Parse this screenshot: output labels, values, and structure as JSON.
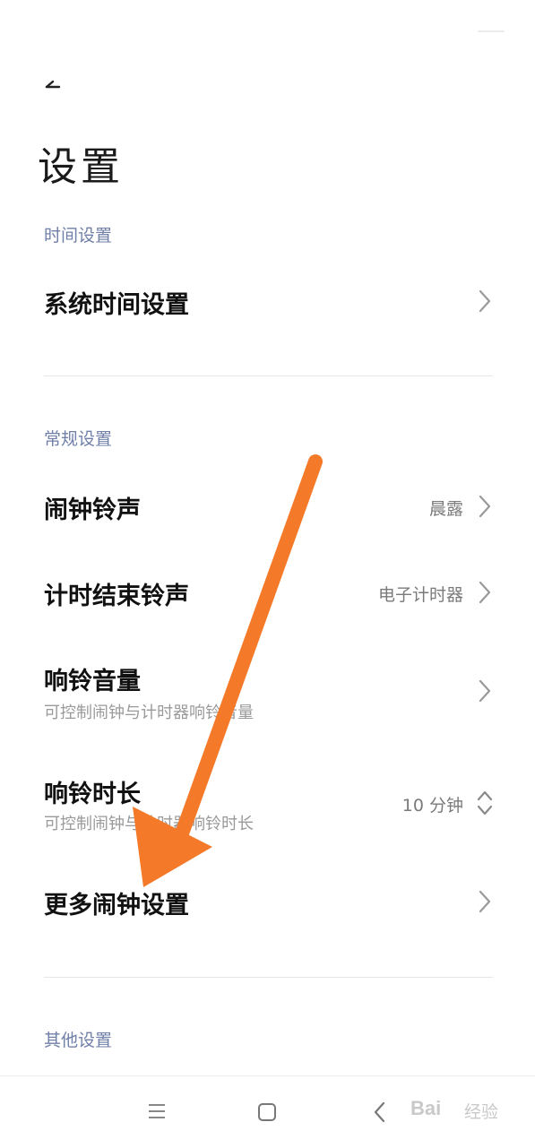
{
  "header": {
    "title": "设置"
  },
  "sections": {
    "time": {
      "label": "时间设置"
    },
    "general": {
      "label": "常规设置"
    },
    "other": {
      "label": "其他设置"
    }
  },
  "rows": {
    "system_time": {
      "title": "系统时间设置"
    },
    "alarm_ringtone": {
      "title": "闹钟铃声",
      "value": "晨露"
    },
    "timer_ringtone": {
      "title": "计时结束铃声",
      "value": "电子计时器"
    },
    "ring_volume": {
      "title": "响铃音量",
      "subtitle": "可控制闹钟与计时器响铃音量"
    },
    "ring_duration": {
      "title": "响铃时长",
      "subtitle": "可控制闹钟与计时器响铃时长",
      "value": "10 分钟"
    },
    "more_alarm": {
      "title": "更多闹钟设置"
    }
  },
  "watermark": {
    "brand": "Bai",
    "sub": "经验"
  },
  "colors": {
    "section_label": "#6f7fa8",
    "annotation_arrow": "#f47a2a"
  },
  "icons": {
    "back": "back-arrow-icon",
    "chevron": "chevron-right-icon",
    "stepper": "up-down-chevron-icon",
    "nav_menu": "menu-icon",
    "nav_home": "home-square-icon",
    "nav_back": "back-chevron-icon"
  }
}
